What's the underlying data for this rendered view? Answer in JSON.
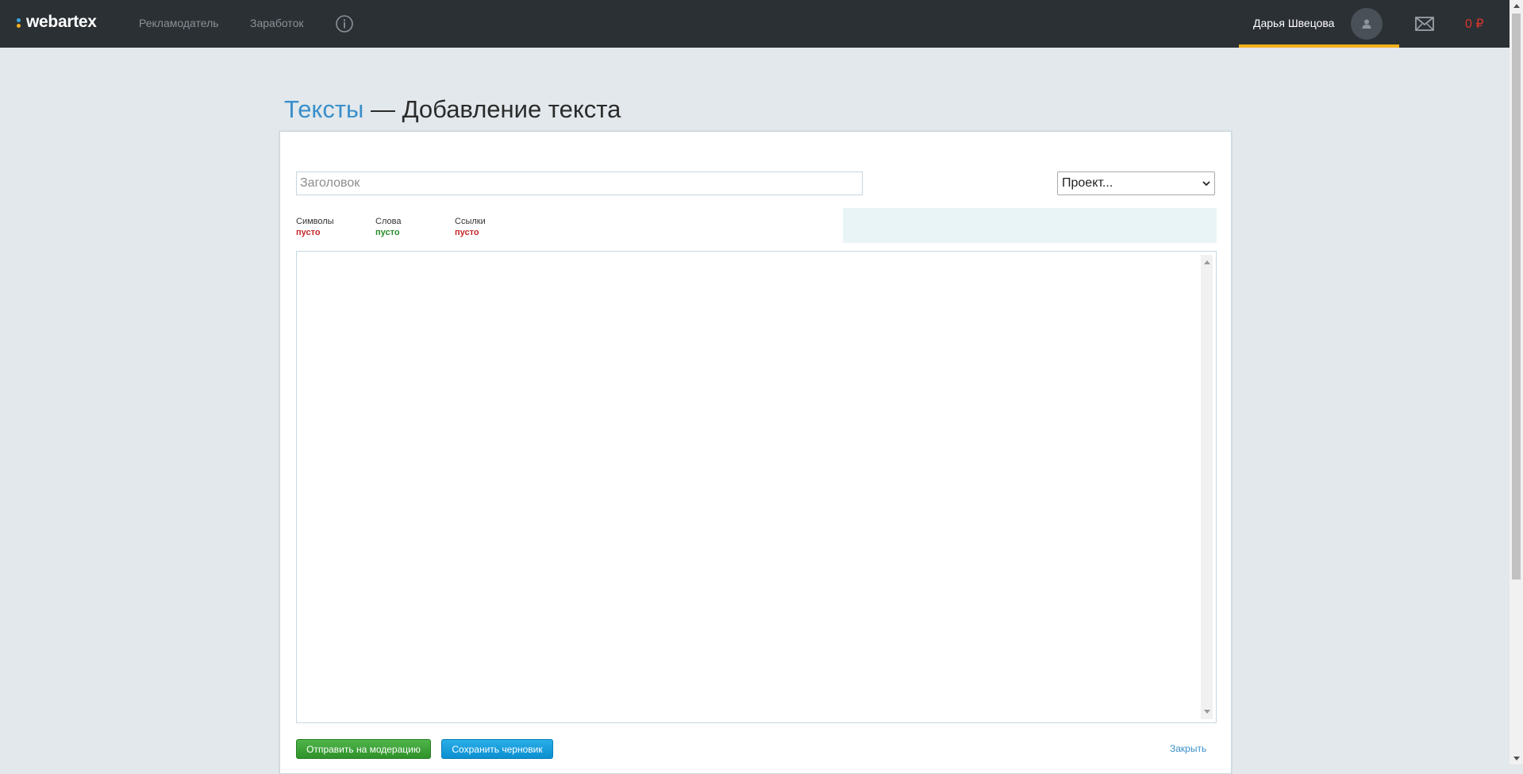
{
  "header": {
    "logo_text": "webartex",
    "nav": [
      {
        "label": "Рекламодатель"
      },
      {
        "label": "Заработок"
      }
    ],
    "user_name": "Дарья Швецова",
    "balance": "0 ₽",
    "accent_color": "#f2b01e"
  },
  "page": {
    "breadcrumb": "Тексты",
    "separator": " — ",
    "title": "Добавление текста"
  },
  "form": {
    "title_placeholder": "Заголовок",
    "title_value": "",
    "project_select": {
      "selected": "Проект..."
    },
    "stats": [
      {
        "label": "Символы",
        "value": "пусто",
        "status": "red"
      },
      {
        "label": "Слова",
        "value": "пусто",
        "status": "green"
      },
      {
        "label": "Ссылки",
        "value": "пусто",
        "status": "red"
      }
    ],
    "editor_content": ""
  },
  "actions": {
    "submit_label": "Отправить на модерацию",
    "draft_label": "Сохранить черновик",
    "close_label": "Закрыть"
  },
  "icons": [
    "info-icon",
    "user-icon",
    "mail-icon",
    "chevron-down-icon"
  ]
}
